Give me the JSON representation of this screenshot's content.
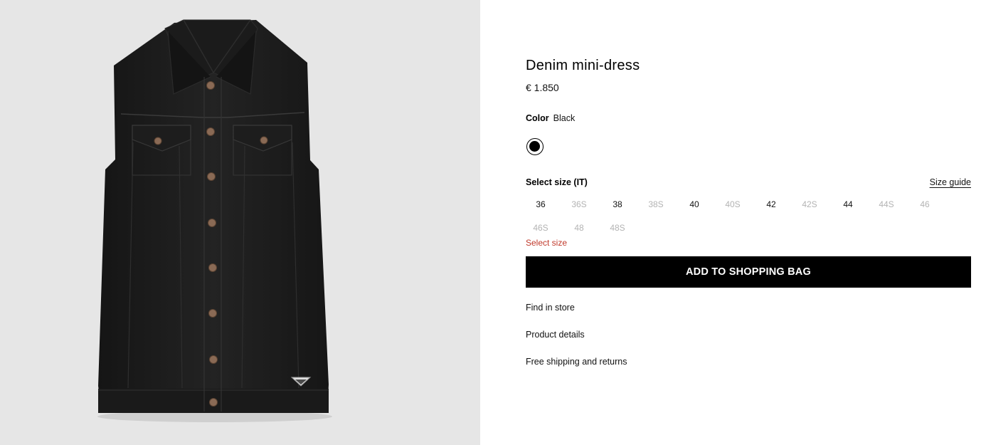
{
  "gallery": {
    "image_alt": "Black sleeveless denim mini-dress"
  },
  "product": {
    "name": "Denim mini-dress",
    "price": "€ 1.850"
  },
  "color": {
    "label": "Color",
    "value": "Black",
    "swatch_hex": "#000000"
  },
  "size": {
    "heading": "Select size (IT)",
    "guide_label": "Size guide",
    "options": [
      {
        "label": "36",
        "available": true
      },
      {
        "label": "36S",
        "available": false
      },
      {
        "label": "38",
        "available": true
      },
      {
        "label": "38S",
        "available": false
      },
      {
        "label": "40",
        "available": true
      },
      {
        "label": "40S",
        "available": false
      },
      {
        "label": "42",
        "available": true
      },
      {
        "label": "42S",
        "available": false
      },
      {
        "label": "44",
        "available": true
      },
      {
        "label": "44S",
        "available": false
      },
      {
        "label": "46",
        "available": false
      },
      {
        "label": "46S",
        "available": false
      },
      {
        "label": "48",
        "available": false
      },
      {
        "label": "48S",
        "available": false
      }
    ],
    "error": "Select size"
  },
  "actions": {
    "add_to_bag": "ADD TO SHOPPING BAG"
  },
  "links": {
    "find_in_store": "Find in store",
    "product_details": "Product details",
    "shipping": "Free shipping and returns"
  },
  "colors": {
    "error_red": "#c0392b",
    "unavailable_gray": "#b3b3b3",
    "gallery_bg": "#e6e6e6"
  }
}
